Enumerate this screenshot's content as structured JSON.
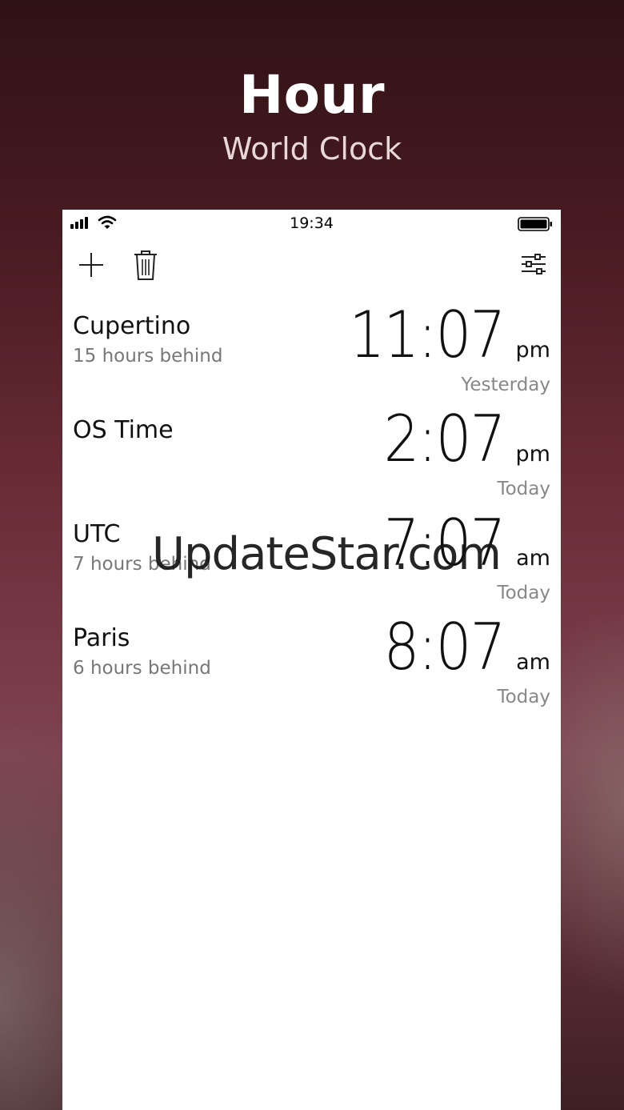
{
  "hero": {
    "title": "Hour",
    "subtitle": "World Clock"
  },
  "status_bar": {
    "time": "19:34",
    "icons": [
      "signal-icon",
      "wifi-icon",
      "battery-icon"
    ]
  },
  "toolbar": {
    "icons": [
      "plus-icon",
      "trash-icon",
      "sliders-icon"
    ]
  },
  "cities": [
    {
      "name": "Cupertino",
      "offset": "15 hours behind",
      "time": "11:07",
      "ampm": "pm",
      "day": "Yesterday"
    },
    {
      "name": "OS Time",
      "offset": "",
      "time": "2:07",
      "ampm": "pm",
      "day": "Today"
    },
    {
      "name": "UTC",
      "offset": "7 hours behind",
      "time": "7:07",
      "ampm": "am",
      "day": "Today"
    },
    {
      "name": "Paris",
      "offset": "6 hours behind",
      "time": "8:07",
      "ampm": "am",
      "day": "Today"
    }
  ],
  "watermark": "UpdateStar.com",
  "colors": {
    "background": "#4a1b22",
    "card": "#ffffff",
    "text": "#111111",
    "secondary_text": "#777777"
  }
}
